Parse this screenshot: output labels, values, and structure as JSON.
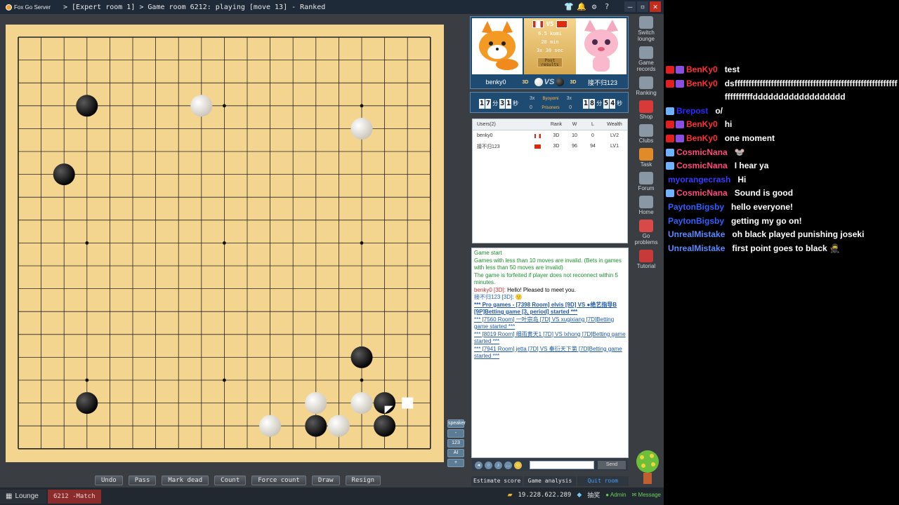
{
  "titlebar": {
    "app": "Fox Go Server",
    "breadcrumb": "> [Expert room 1] > Game room 6212: playing [move 13] - Ranked",
    "icons": [
      "shirt-icon",
      "bell-icon",
      "gear-icon",
      "help-icon"
    ],
    "window_buttons": [
      "minimize",
      "restore",
      "close"
    ]
  },
  "board": {
    "size": 19,
    "stones": [
      {
        "col": 3,
        "row": 3,
        "color": "black"
      },
      {
        "col": 8,
        "row": 3,
        "color": "white"
      },
      {
        "col": 15,
        "row": 4,
        "color": "white"
      },
      {
        "col": 2,
        "row": 6,
        "color": "black"
      },
      {
        "col": 15,
        "row": 14,
        "color": "black"
      },
      {
        "col": 3,
        "row": 16,
        "color": "black"
      },
      {
        "col": 13,
        "row": 16,
        "color": "white"
      },
      {
        "col": 15,
        "row": 16,
        "color": "white"
      },
      {
        "col": 16,
        "row": 16,
        "color": "black"
      },
      {
        "col": 11,
        "row": 17,
        "color": "white"
      },
      {
        "col": 13,
        "row": 17,
        "color": "black"
      },
      {
        "col": 14,
        "row": 17,
        "color": "white"
      },
      {
        "col": 16,
        "row": 17,
        "color": "black"
      }
    ],
    "last_move": {
      "col": 16,
      "row": 16
    },
    "hover": {
      "col": 17,
      "row": 16
    }
  },
  "board_tools": [
    "speaker",
    "-",
    "123",
    "AI",
    "+"
  ],
  "bottom_buttons": [
    "Undo",
    "Pass",
    "Mark dead",
    "Count",
    "Force count",
    "Draw",
    "Resign"
  ],
  "statusbar": {
    "lounge": "Lounge",
    "match": "6212 -Match",
    "ip": "19.228.622.289",
    "lottery": "抽奖",
    "admin": "Admin",
    "message": "Message"
  },
  "players": {
    "komi": "6.5 komi",
    "time": "20 min",
    "byoyomi": "3x 30 sec",
    "post": "Post results",
    "vs": "VS",
    "left": {
      "name": "benky0",
      "rank": "3D",
      "flag": "ca"
    },
    "right": {
      "name": "接不归123",
      "rank": "3D",
      "flag": "cn"
    }
  },
  "clock": {
    "left": [
      "1",
      "7",
      "分",
      "3",
      "1",
      "秒"
    ],
    "right": [
      "1",
      "8",
      "分",
      "5",
      "4",
      "秒"
    ],
    "byoyomi_left": "3x",
    "byoyomi_right": "3x",
    "byoyomi_label": "Byoyomi",
    "prisoners_label": "Prisoners",
    "prisoners_left": "0",
    "prisoners_right": "0"
  },
  "users": {
    "headers": [
      "Users(2)",
      "Rank",
      "W",
      "L",
      "Wealth"
    ],
    "rows": [
      {
        "name": "benky0",
        "flag": "ca",
        "rank": "3D",
        "w": "10",
        "l": "0",
        "wealth": "LV2"
      },
      {
        "name": "接不归123",
        "flag": "cn",
        "rank": "3D",
        "w": "96",
        "l": "94",
        "wealth": "LV1"
      }
    ]
  },
  "chat": {
    "game_start": "Game start",
    "rule1": "Games with less than 10 moves are invalid. (Bets in games with less than 50 moves are invalid)",
    "rule2": "The game is forfeited if player does not reconnect within 5 minutes.",
    "msg1_user": "benky0 [3D]:",
    "msg1_text": " Hello! Pleased to meet you.",
    "msg2_user": "接不归123 [3D]:",
    "pro_link": "*** Pro games - [7398 Room] elvis [9D] VS ●绝艺指导B [9P]Betting game [3, period] started ***",
    "link1": "*** [7560 Room] 一叶宗岛 [7D] VS xugixiang [7D]Betting game started ***",
    "link2": "*** [8019 Room] 细雨黄天1 [7D] VS lxhong [7D]Betting game started ***",
    "link3": "*** [7941 Room] jetta [7D] VS 秦衍天下第 [7D]Betting game started ***",
    "send": "Send"
  },
  "analysis_buttons": [
    "Estimate score",
    "Game analysis",
    "Quit room"
  ],
  "sidebar": [
    {
      "label": "Switch lounge",
      "icon": "switch-icon",
      "color": "#8a97a5"
    },
    {
      "label": "Game records",
      "icon": "records-icon",
      "color": "#8a97a5"
    },
    {
      "label": "Ranking",
      "icon": "ranking-icon",
      "color": "#8a97a5"
    },
    {
      "label": "Shop",
      "icon": "shop-icon",
      "color": "#d83a3a"
    },
    {
      "label": "Clubs",
      "icon": "clubs-icon",
      "color": "#8a97a5"
    },
    {
      "label": "Task",
      "icon": "task-icon",
      "color": "#e08a2a"
    },
    {
      "label": "Forum",
      "icon": "forum-icon",
      "color": "#8a97a5"
    },
    {
      "label": "Home",
      "icon": "home-icon",
      "color": "#8a97a5"
    },
    {
      "label": "Go problems",
      "icon": "problems-icon",
      "color": "#d84a4a"
    },
    {
      "label": "Tutorial",
      "icon": "tutorial-icon",
      "color": "#c83a3a"
    }
  ],
  "stream_chat": [
    {
      "name": "BenKy0",
      "color": "#ff3030",
      "badges": [
        "red",
        "purple"
      ],
      "text": "test"
    },
    {
      "name": "BenKy0",
      "color": "#ff3030",
      "badges": [
        "red",
        "purple"
      ],
      "text": "dsffffffffffffffffffffffffffffffffffffffffffffffffffffffffffffffffffffdddddddddddddddddd"
    },
    {
      "name": "Brepost",
      "color": "#2a2aff",
      "badges": [
        "crown"
      ],
      "text": "o/"
    },
    {
      "name": "BenKy0",
      "color": "#ff3030",
      "badges": [
        "red",
        "purple"
      ],
      "text": "hi"
    },
    {
      "name": "BenKy0",
      "color": "#ff3030",
      "badges": [
        "red",
        "purple"
      ],
      "text": "one moment"
    },
    {
      "name": "CosmicNana",
      "color": "#ff4a7a",
      "badges": [
        "crown"
      ],
      "text": "🐭"
    },
    {
      "name": "CosmicNana",
      "color": "#ff4a7a",
      "badges": [
        "crown"
      ],
      "text": "I hear ya"
    },
    {
      "name": "myorangecrash",
      "color": "#3a3aff",
      "badges": [],
      "text": "Hi"
    },
    {
      "name": "CosmicNana",
      "color": "#ff4a7a",
      "badges": [
        "crown"
      ],
      "text": "Sound is good"
    },
    {
      "name": "PaytonBigsby",
      "color": "#3060ff",
      "badges": [],
      "text": "hello everyone!"
    },
    {
      "name": "PaytonBigsby",
      "color": "#3060ff",
      "badges": [],
      "text": "getting my go on!"
    },
    {
      "name": "UnrealMistake",
      "color": "#5a8aff",
      "badges": [],
      "text": "oh black played punishing joseki"
    },
    {
      "name": "UnrealMistake",
      "color": "#5a8aff",
      "badges": [],
      "text": "first point goes to black 🥷"
    }
  ]
}
